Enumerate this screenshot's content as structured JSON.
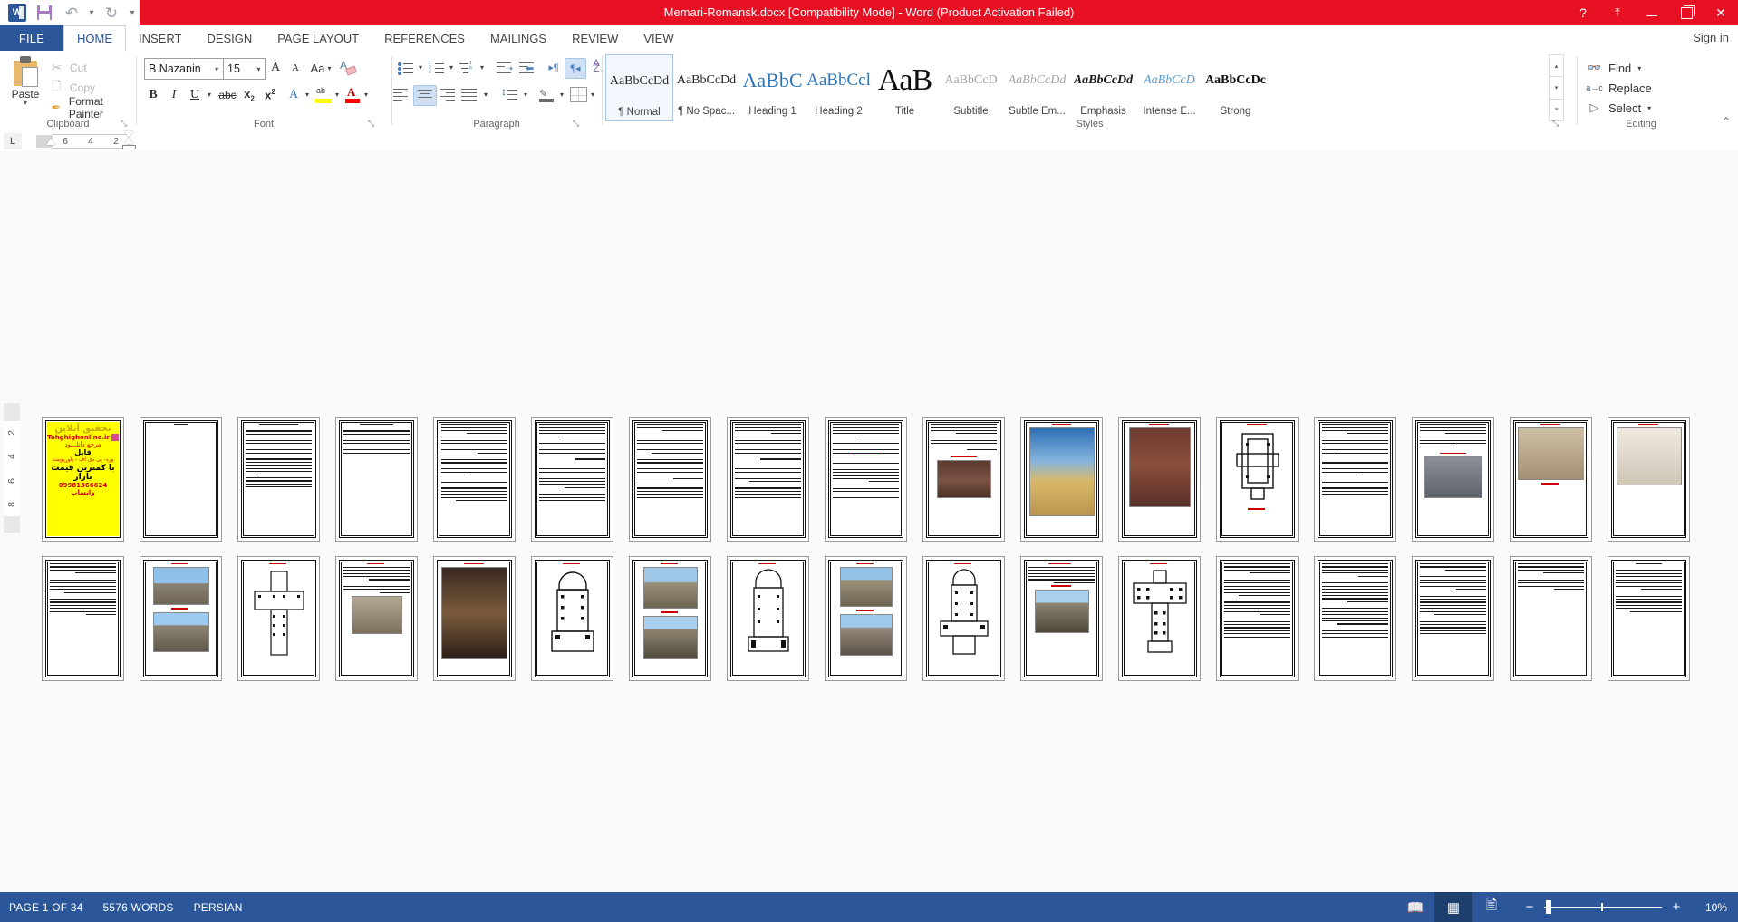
{
  "window": {
    "title": "Memari-Romansk.docx [Compatibility Mode]  -  Word (Product Activation Failed)",
    "help_label": "?",
    "ribbon_display_label": "⤒",
    "minimize_label": "",
    "restore_label": "",
    "close_label": "✕",
    "signin_label": "Sign in"
  },
  "quick_access": {
    "word_logo": "W",
    "save_label": "save-icon",
    "undo_label": "↶",
    "undo_caret": "▾",
    "redo_label": "↻",
    "more_caret": "▾"
  },
  "tabs": [
    {
      "label": "FILE",
      "active": false
    },
    {
      "label": "HOME",
      "active": true
    },
    {
      "label": "INSERT",
      "active": false
    },
    {
      "label": "DESIGN",
      "active": false
    },
    {
      "label": "PAGE LAYOUT",
      "active": false
    },
    {
      "label": "REFERENCES",
      "active": false
    },
    {
      "label": "MAILINGS",
      "active": false
    },
    {
      "label": "REVIEW",
      "active": false
    },
    {
      "label": "VIEW",
      "active": false
    }
  ],
  "ribbon": {
    "collapse_caret": "⌃",
    "clipboard": {
      "group_label": "Clipboard",
      "paste_label": "Paste",
      "paste_caret": "▾",
      "cut_label": "Cut",
      "copy_label": "Copy",
      "format_painter_label": "Format Painter",
      "dialog_launcher": "⤡"
    },
    "font": {
      "group_label": "Font",
      "font_name": "B Nazanin",
      "font_size": "15",
      "grow_font": "A",
      "shrink_font": "A",
      "change_case": "Aa",
      "clear_formatting": "A",
      "bold": "B",
      "italic": "I",
      "underline": "U",
      "strikethrough": "abc",
      "subscript": "x",
      "superscript": "x",
      "text_effects": "A",
      "highlight": "ab",
      "font_color": "A",
      "caret": "▾",
      "dialog_launcher": "⤡"
    },
    "paragraph": {
      "group_label": "Paragraph",
      "bullets": "bullets-icon",
      "numbering": "numbering-icon",
      "multilevel": "multilevel-list-icon",
      "decrease_indent": "decrease-indent-icon",
      "increase_indent": "increase-indent-icon",
      "ltr_label": "¶",
      "rtl_label": "¶",
      "sort": "A\nZ",
      "show_marks": "¶",
      "align_left": "align-left-icon",
      "align_center": "align-center-icon",
      "align_right": "align-right-icon",
      "justify": "justify-icon",
      "line_spacing": "line-spacing-icon",
      "shading": "shading-icon",
      "borders": "borders-icon",
      "caret": "▾",
      "dialog_launcher": "⤡"
    },
    "styles": {
      "group_label": "Styles",
      "dialog_launcher": "⤡",
      "scroll_up": "▴",
      "scroll_down": "▾",
      "more": "≡",
      "items": [
        {
          "preview": "AaBbCcDd",
          "name": "¶ Normal",
          "selected": true
        },
        {
          "preview": "AaBbCcDd",
          "name": "¶ No Spac...",
          "selected": false
        },
        {
          "preview": "AaBbC",
          "name": "Heading 1",
          "selected": false
        },
        {
          "preview": "AaBbCcl",
          "name": "Heading 2",
          "selected": false
        },
        {
          "preview": "AaB",
          "name": "Title",
          "selected": false
        },
        {
          "preview": "AaBbCcD",
          "name": "Subtitle",
          "selected": false
        },
        {
          "preview": "AaBbCcDd",
          "name": "Subtle Em...",
          "selected": false
        },
        {
          "preview": "AaBbCcDd",
          "name": "Emphasis",
          "selected": false
        },
        {
          "preview": "AaBbCcD",
          "name": "Intense E...",
          "selected": false
        },
        {
          "preview": "AaBbCcDc",
          "name": "Strong",
          "selected": false
        }
      ]
    },
    "editing": {
      "group_label": "Editing",
      "find_label": "Find",
      "find_caret": "▾",
      "replace_label": "Replace",
      "select_label": "Select",
      "select_caret": "▾"
    }
  },
  "ruler": {
    "tab_selector": "L",
    "horizontal_marks": [
      "6",
      "4",
      "2"
    ],
    "vertical_marks": [
      "2",
      "4",
      "6",
      "8"
    ]
  },
  "status_bar": {
    "page_label": "PAGE 1 OF 34",
    "words_label": "5576 WORDS",
    "language_label": "PERSIAN",
    "view_read": "read-mode-icon",
    "view_print": "print-layout-icon",
    "view_web": "web-layout-icon",
    "zoom_out": "−",
    "zoom_in": "+",
    "zoom_level": "10%"
  },
  "document": {
    "ad_page": {
      "line1": "تحقیق آنلاین",
      "line2": "Tahghighonline.ir",
      "line3": "مرجع دانلـــود",
      "line4": "فایل",
      "line5": "ورد- پی دی اف - پاورپوینت",
      "line6": "با کمترین قیمت بازار",
      "line7": "09981366624 واتساپ"
    },
    "total_pages": 34,
    "pages": [
      {
        "n": 1,
        "kind": "ad"
      },
      {
        "n": 2,
        "kind": "blank"
      },
      {
        "n": 3,
        "kind": "toc"
      },
      {
        "n": 4,
        "kind": "toc"
      },
      {
        "n": 5,
        "kind": "text"
      },
      {
        "n": 6,
        "kind": "text"
      },
      {
        "n": 7,
        "kind": "text"
      },
      {
        "n": 8,
        "kind": "text"
      },
      {
        "n": 9,
        "kind": "text"
      },
      {
        "n": 10,
        "kind": "text-image",
        "image": "brown-building"
      },
      {
        "n": 11,
        "kind": "image-large",
        "image": "yellow-cathedral"
      },
      {
        "n": 12,
        "kind": "image-plan",
        "image": "brick-tower"
      },
      {
        "n": 13,
        "kind": "text-image",
        "image": "grey-building"
      },
      {
        "n": 14,
        "kind": "image-large",
        "image": "stone-facade"
      },
      {
        "n": 15,
        "kind": "image-interior",
        "image": "white-interior"
      },
      {
        "n": 16,
        "kind": "text"
      },
      {
        "n": 17,
        "kind": "image-two",
        "image": "cathedral-pair"
      },
      {
        "n": 18,
        "kind": "plan",
        "image": "cross-plan"
      },
      {
        "n": 19,
        "kind": "text-image",
        "image": "church-photo"
      },
      {
        "n": 20,
        "kind": "image-large",
        "image": "facade-color"
      },
      {
        "n": 21,
        "kind": "plan",
        "image": "rect-plan"
      },
      {
        "n": 22,
        "kind": "image-two",
        "image": "church-pair"
      },
      {
        "n": 23,
        "kind": "plan",
        "image": "basilica-plan"
      },
      {
        "n": 24,
        "kind": "image-two",
        "image": "twin-towers"
      },
      {
        "n": 25,
        "kind": "plan",
        "image": "long-plan"
      },
      {
        "n": 26,
        "kind": "image-large",
        "image": "cathedral-spires"
      },
      {
        "n": 27,
        "kind": "plan",
        "image": "cross-plan2"
      },
      {
        "n": 28,
        "kind": "text"
      },
      {
        "n": 29,
        "kind": "text"
      },
      {
        "n": 30,
        "kind": "text"
      },
      {
        "n": 31,
        "kind": "text"
      },
      {
        "n": 32,
        "kind": "text"
      },
      {
        "n": 33,
        "kind": "blank"
      },
      {
        "n": 34,
        "kind": "text"
      }
    ]
  }
}
